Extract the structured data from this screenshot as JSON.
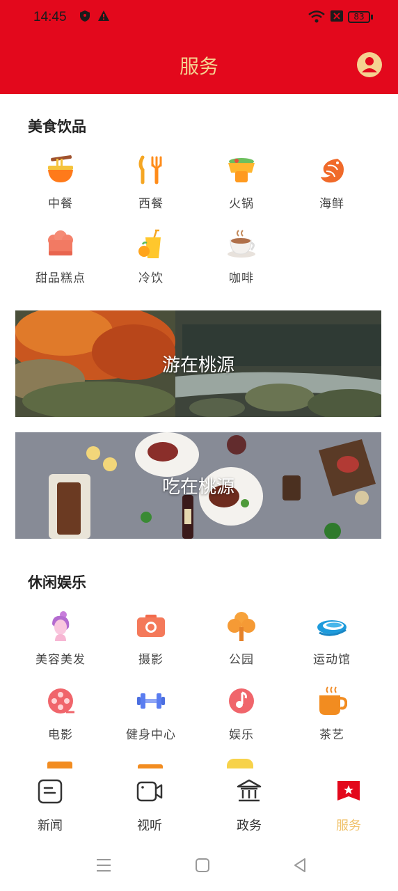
{
  "status_bar": {
    "time": "14:45",
    "battery": "83"
  },
  "header": {
    "title": "服务"
  },
  "sections": {
    "food": {
      "title": "美食饮品",
      "items": [
        {
          "label": "中餐",
          "icon": "noodle-bowl-icon"
        },
        {
          "label": "西餐",
          "icon": "fork-knife-icon"
        },
        {
          "label": "火锅",
          "icon": "hotpot-icon"
        },
        {
          "label": "海鲜",
          "icon": "shrimp-icon"
        },
        {
          "label": "甜品糕点",
          "icon": "cupcake-icon"
        },
        {
          "label": "冷饮",
          "icon": "cold-drink-icon"
        },
        {
          "label": "咖啡",
          "icon": "coffee-cup-icon"
        }
      ]
    },
    "banners": [
      {
        "text": "游在桃源"
      },
      {
        "text": "吃在桃源"
      }
    ],
    "leisure": {
      "title": "休闲娱乐",
      "items": [
        {
          "label": "美容美发",
          "icon": "woman-hair-icon"
        },
        {
          "label": "摄影",
          "icon": "camera-icon"
        },
        {
          "label": "公园",
          "icon": "tree-icon"
        },
        {
          "label": "运动馆",
          "icon": "swimming-pool-icon"
        },
        {
          "label": "电影",
          "icon": "film-reel-icon"
        },
        {
          "label": "健身中心",
          "icon": "dumbbell-icon"
        },
        {
          "label": "娱乐",
          "icon": "music-note-icon"
        },
        {
          "label": "茶艺",
          "icon": "tea-cup-icon"
        }
      ]
    }
  },
  "bottom_nav": [
    {
      "label": "新闻",
      "icon": "news-icon",
      "active": false
    },
    {
      "label": "视听",
      "icon": "video-camera-icon",
      "active": false
    },
    {
      "label": "政务",
      "icon": "government-building-icon",
      "active": false
    },
    {
      "label": "服务",
      "icon": "service-bookmark-icon",
      "active": true
    }
  ],
  "colors": {
    "header_bg": "#e3081c",
    "header_text": "#f5d291",
    "active_tab": "#f0c36d"
  }
}
